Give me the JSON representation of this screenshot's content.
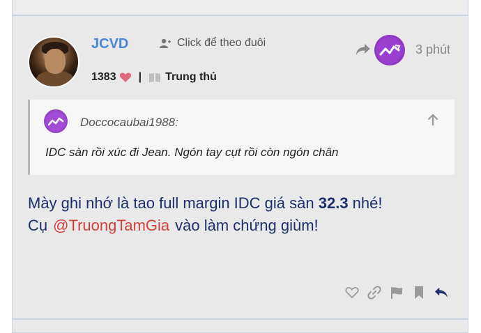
{
  "post": {
    "username": "JCVD",
    "follow_label": "Click để theo đuôi",
    "likes_count": "1383",
    "separator": "|",
    "badge_label": "Trung thủ",
    "time": "3 phút"
  },
  "quote": {
    "username": "Doccocaubai1988:",
    "text": "IDC sàn rồi xúc đi Jean. Ngón tay cụt rồi còn ngón chân"
  },
  "message": {
    "line1_prefix": "Mày ghi nhớ là tao full margin IDC giá sàn ",
    "line1_number": "32.3",
    "line1_suffix": " nhé!",
    "line2_prefix": "Cụ",
    "mention": "@TruongTamGia",
    "line2_suffix": "vào làm chứng giùm!"
  },
  "icons": {
    "follow": "person-plus-icon",
    "heart": "heart-icon",
    "badge": "book-icon",
    "reply_to": "share-arrow-icon",
    "quote_up": "arrow-up-icon",
    "like": "heart-outline-icon",
    "link": "link-icon",
    "flag": "flag-icon",
    "bookmark": "bookmark-icon",
    "reply": "reply-icon"
  },
  "colors": {
    "username": "#4a86d6",
    "message": "#1c2f6b",
    "mention": "#d1403b",
    "heart": "#e0697f",
    "reply": "#1c2f6b"
  }
}
